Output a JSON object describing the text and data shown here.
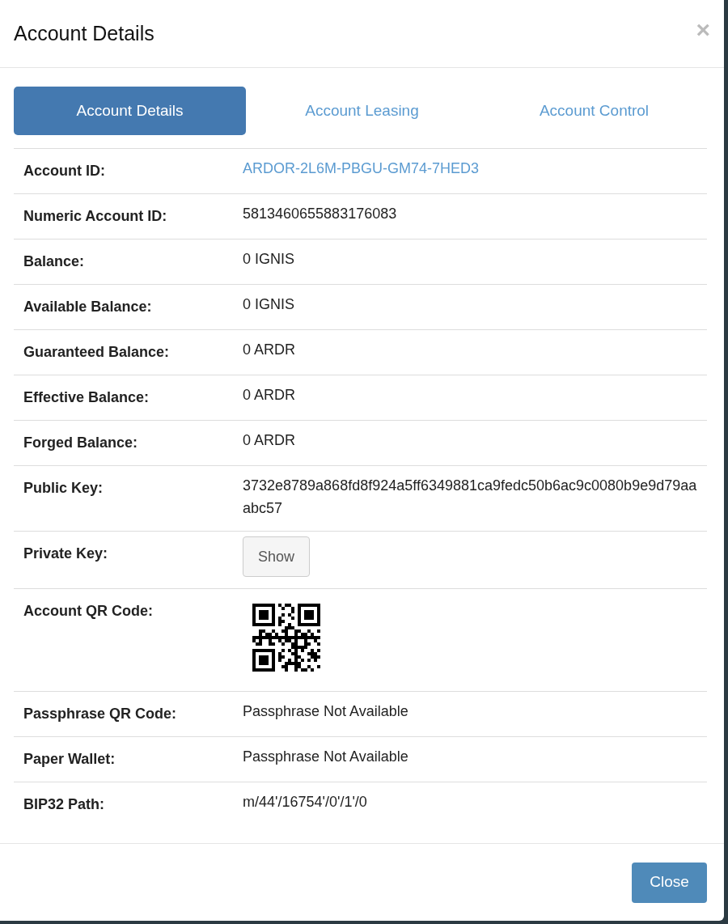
{
  "dialog": {
    "title": "Account Details",
    "close_icon": "×"
  },
  "tabs": [
    {
      "label": "Account Details",
      "selected": true
    },
    {
      "label": "Account Leasing",
      "selected": false
    },
    {
      "label": "Account Control",
      "selected": false
    }
  ],
  "rows": [
    {
      "label": "Account ID:",
      "kind": "link",
      "value": "ARDOR-2L6M-PBGU-GM74-7HED3"
    },
    {
      "label": "Numeric Account ID:",
      "kind": "text",
      "value": "5813460655883176083"
    },
    {
      "label": "Balance:",
      "kind": "text",
      "value": "0 IGNIS"
    },
    {
      "label": "Available Balance:",
      "kind": "text",
      "value": "0 IGNIS"
    },
    {
      "label": "Guaranteed Balance:",
      "kind": "text",
      "value": "0 ARDR"
    },
    {
      "label": "Effective Balance:",
      "kind": "text",
      "value": "0 ARDR"
    },
    {
      "label": "Forged Balance:",
      "kind": "text",
      "value": "0 ARDR"
    },
    {
      "label": "Public Key:",
      "kind": "text",
      "value": "3732e8789a868fd8f924a5ff6349881ca9fedc50b6ac9c0080b9e9d79aaabc57"
    },
    {
      "label": "Private Key:",
      "kind": "button",
      "value": "Show"
    },
    {
      "label": "Account QR Code:",
      "kind": "qr"
    },
    {
      "label": "Passphrase QR Code:",
      "kind": "text",
      "value": "Passphrase Not Available"
    },
    {
      "label": "Paper Wallet:",
      "kind": "text",
      "value": "Passphrase Not Available"
    },
    {
      "label": "BIP32 Path:",
      "kind": "text",
      "value": "m/44'/16754'/0'/1'/0"
    }
  ],
  "footer": {
    "button": "Close"
  }
}
